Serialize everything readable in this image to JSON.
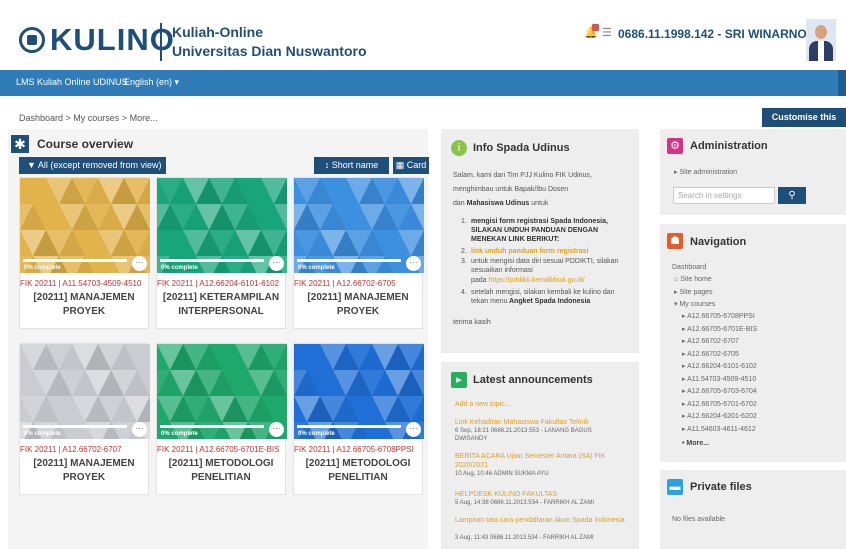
{
  "header": {
    "logo_text": "KULINO",
    "brand_line1": "Kuliah-Online",
    "brand_line2": "Universitas Dian Nuswantoro",
    "user_name": "0686.11.1998.142 - SRI WINARNO",
    "notification_icon": "bell-icon",
    "message_icon": "chat-icon"
  },
  "navbar": {
    "site_name": "LMS Kuliah Online UDINUS",
    "language": "English (en) ▾"
  },
  "breadcrumb": [
    "Dashboard",
    "My courses",
    "More..."
  ],
  "customise_label": "Customise this page",
  "overview": {
    "title": "Course overview",
    "filter_label": "All (except removed from view)",
    "sort_label": "Short name",
    "view_label": "Card",
    "courses": [
      {
        "category": "FIK 20211 | A11.54703-4509-4510",
        "name": "[20211] MANAJEMEN PROYEK",
        "progress": "0% complete",
        "color": "#e2b24b"
      },
      {
        "category": "FIK 20211 | A12.66204-6101-6102",
        "name": "[20211] KETERAMPILAN INTERPERSONAL",
        "progress": "0% complete",
        "color": "#18a57a"
      },
      {
        "category": "FIK 20211 | A12.66702-6705",
        "name": "[20211] MANAJEMEN PROYEK",
        "progress": "0% complete",
        "color": "#3d8fe0"
      },
      {
        "category": "FIK 20211 | A12.66702-6707",
        "name": "[20211] MANAJEMEN PROYEK",
        "progress": "0% complete",
        "color": "#c9cdd1"
      },
      {
        "category": "FIK 20211 | A12.66705-6701E-BIS",
        "name": "[20211] METODOLOGI PENELITIAN",
        "progress": "0% complete",
        "color": "#1fa86c"
      },
      {
        "category": "FIK 20211 | A12.66705-6708PPSI",
        "name": "[20211] METODOLOGI PENELITIAN",
        "progress": "0% complete",
        "color": "#1f6fd6"
      }
    ]
  },
  "info": {
    "title": "Info Spada Udinus",
    "para1": "Salam, kami dari Tim PJJ Kulino FIK Udinus,",
    "para2": "menghimbau untuk Bapak/Ibu Dosen",
    "para3_prefix": "dan",
    "para3_bold": "Mahasiswa Udinus",
    "para3_suffix": "untuk",
    "item1": "mengisi form registrasi Spada Indonesia, SILAKAN UNDUH PANDUAN DENGAN MENEKAN LINK BERIKUT:",
    "item2": "link unduh panduan form registrasi",
    "item3a": "untuk mengisi data diri sesuai PDDIKTI, silakan sesuaikan informasi",
    "item3b_prefix": "pada",
    "item3b_link": "https://pddikti.kemdikbud.go.id/",
    "item4a": "setelah mengisi, silakan kembali ke kulino dan tekan menu",
    "item4b": "Angket Spada Indonesia",
    "closing": "terima kasih"
  },
  "announcements": {
    "title": "Latest announcements",
    "add_link": "Add a new topic...",
    "items": [
      {
        "title": "Link Kehadiran Mahasiswa Fakultas Teknik",
        "meta": "6 Sep, 18:21  0686.21.2013.553 - LANANG BAGUS",
        "meta2": "DWISANDY"
      },
      {
        "title": "BERITA ACARA Ujian Semester Antara (SA) FIK 2020/2021",
        "meta": "10 Aug, 10:46  ADMIN SUKMA AYU",
        "meta2": ""
      },
      {
        "title": "HELPDESK KULINO FAKULTAS",
        "meta": "5 Aug, 14:38  0686.11.2013.534 - FARRIKH AL ZAMI",
        "meta2": ""
      },
      {
        "title": "Lampiran tata cara pendaftaran Akun Spada Indonesia",
        "meta": "3 Aug, 11:43  0686.11.2013.534 - FARRIKH AL ZAMI",
        "meta2": ""
      }
    ]
  },
  "administration": {
    "title": "Administration",
    "site_admin": "Site administration",
    "search_placeholder": "Search in settings"
  },
  "navigation": {
    "title": "Navigation",
    "dashboard": "Dashboard",
    "site_home": "Site home",
    "site_pages": "Site pages",
    "my_courses": "My courses",
    "courses": [
      "A12.66705-6708PPSI",
      "A12.66705-6701E-BIS",
      "A12.66702-6707",
      "A12.66702-6705",
      "A12.66204-6101-6102",
      "A11.54703-4509-4510",
      "A12.66705-6703-6704",
      "A12.66705-6701-6702",
      "A12.66204-6201-6202",
      "A11.54603-4611-4612"
    ],
    "more": "More..."
  },
  "private_files": {
    "title": "Private files",
    "empty": "No files available"
  },
  "colors": {
    "primary": "#1f4e79",
    "navbar": "#2f7cb8",
    "accent_link": "#e0a020",
    "category_red": "#c9302c"
  }
}
